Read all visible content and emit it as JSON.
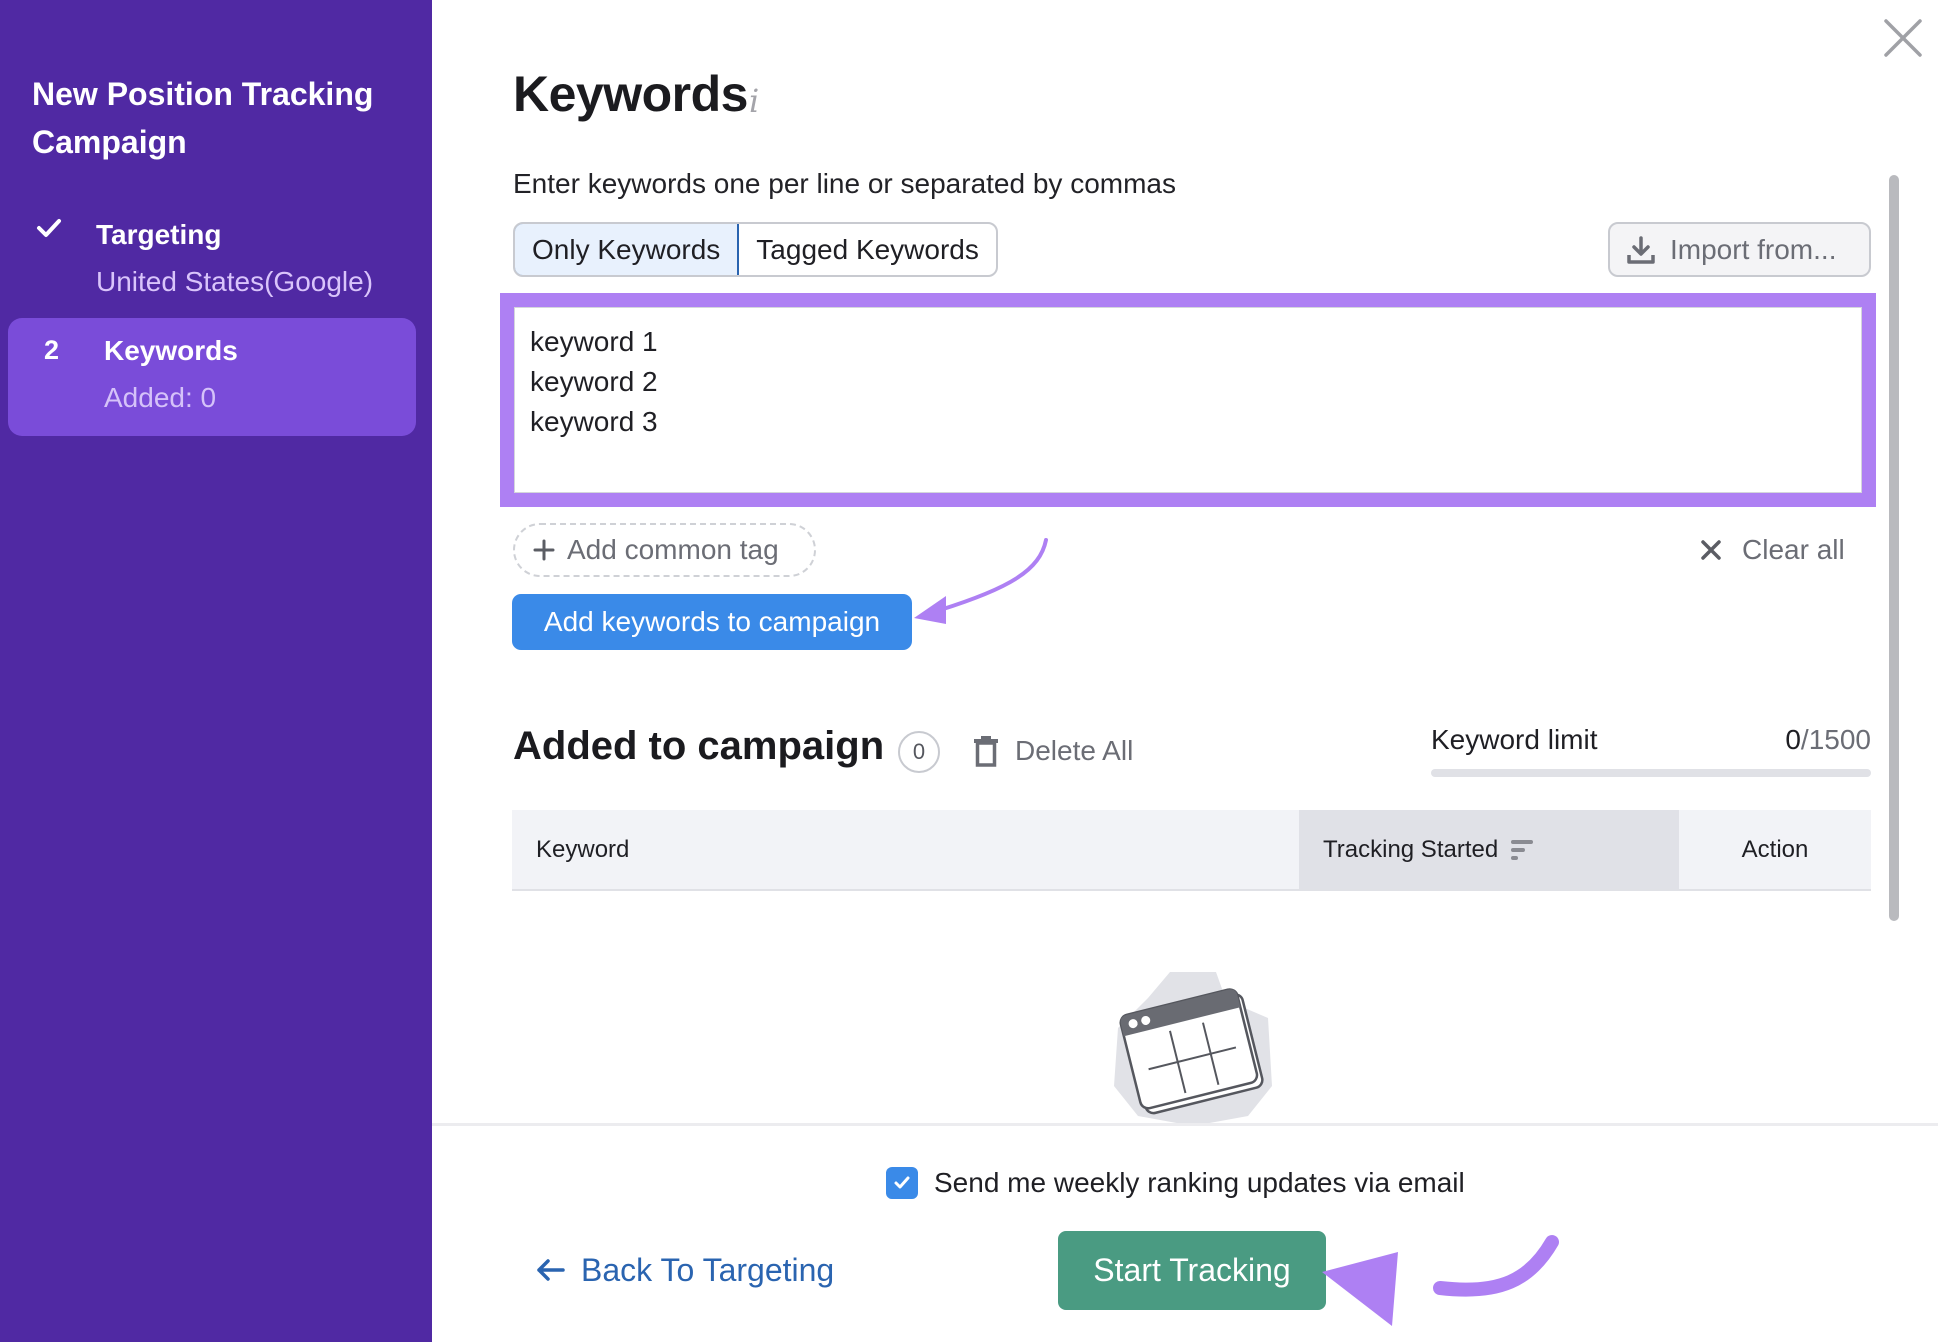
{
  "sidebar": {
    "title": "New Position Tracking Campaign",
    "steps": [
      {
        "marker_icon": "check-icon",
        "marker": "✓",
        "label": "Targeting",
        "sub": "United States(Google)",
        "state": "done"
      },
      {
        "marker": "2",
        "label": "Keywords",
        "sub": "Added: 0",
        "state": "active"
      }
    ]
  },
  "main": {
    "title": "Keywords",
    "info_icon": "i",
    "instruction": "Enter keywords one per line or separated by commas",
    "toggle": [
      {
        "label": "Only Keywords",
        "selected": true
      },
      {
        "label": "Tagged Keywords",
        "selected": false
      }
    ],
    "import_label": "Import from...",
    "keywords_input_value": "keyword 1\nkeyword 2\nkeyword 3",
    "add_tag_label": "Add common tag",
    "clear_all_label": "Clear all",
    "add_keywords_label": "Add keywords to campaign"
  },
  "added": {
    "title": "Added to campaign",
    "count": "0",
    "delete_all_label": "Delete All",
    "limit_label": "Keyword limit",
    "limit_used": "0",
    "limit_total": "/1500",
    "limit_fraction": 0,
    "columns": [
      "Keyword",
      "Tracking Started",
      "Action"
    ]
  },
  "footer": {
    "email_label": "Send me weekly ranking updates via email",
    "email_checked": true,
    "back_label": "Back To Targeting",
    "start_label": "Start Tracking"
  },
  "colors": {
    "sidebar_bg": "#5029a3",
    "sidebar_active": "#7a4cd9",
    "highlight": "#ae80f3",
    "primary_blue": "#3a8ae8",
    "start_green": "#4a9b82",
    "link_blue": "#2a64b0"
  }
}
